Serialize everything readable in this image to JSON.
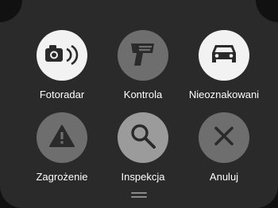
{
  "menu": {
    "items": [
      {
        "key": "fotoradar",
        "label": "Fotoradar",
        "icon": "speed-camera-icon"
      },
      {
        "key": "kontrola",
        "label": "Kontrola",
        "icon": "radar-gun-icon"
      },
      {
        "key": "nieoznakowani",
        "label": "Nieoznakowani",
        "icon": "car-icon"
      },
      {
        "key": "zagrozenie",
        "label": "Zagrożenie",
        "icon": "warning-icon"
      },
      {
        "key": "inspekcja",
        "label": "Inspekcja",
        "icon": "search-icon"
      },
      {
        "key": "anuluj",
        "label": "Anuluj",
        "icon": "close-icon"
      }
    ]
  },
  "colors": {
    "panel": "#2a2a2a",
    "background": "#111111",
    "button_light": "#f2f2f2",
    "button_mid": "#6e6e6e",
    "button_midlight": "#9b9b9b",
    "icon_dark": "#2a2a2a",
    "label": "#ffffff"
  }
}
